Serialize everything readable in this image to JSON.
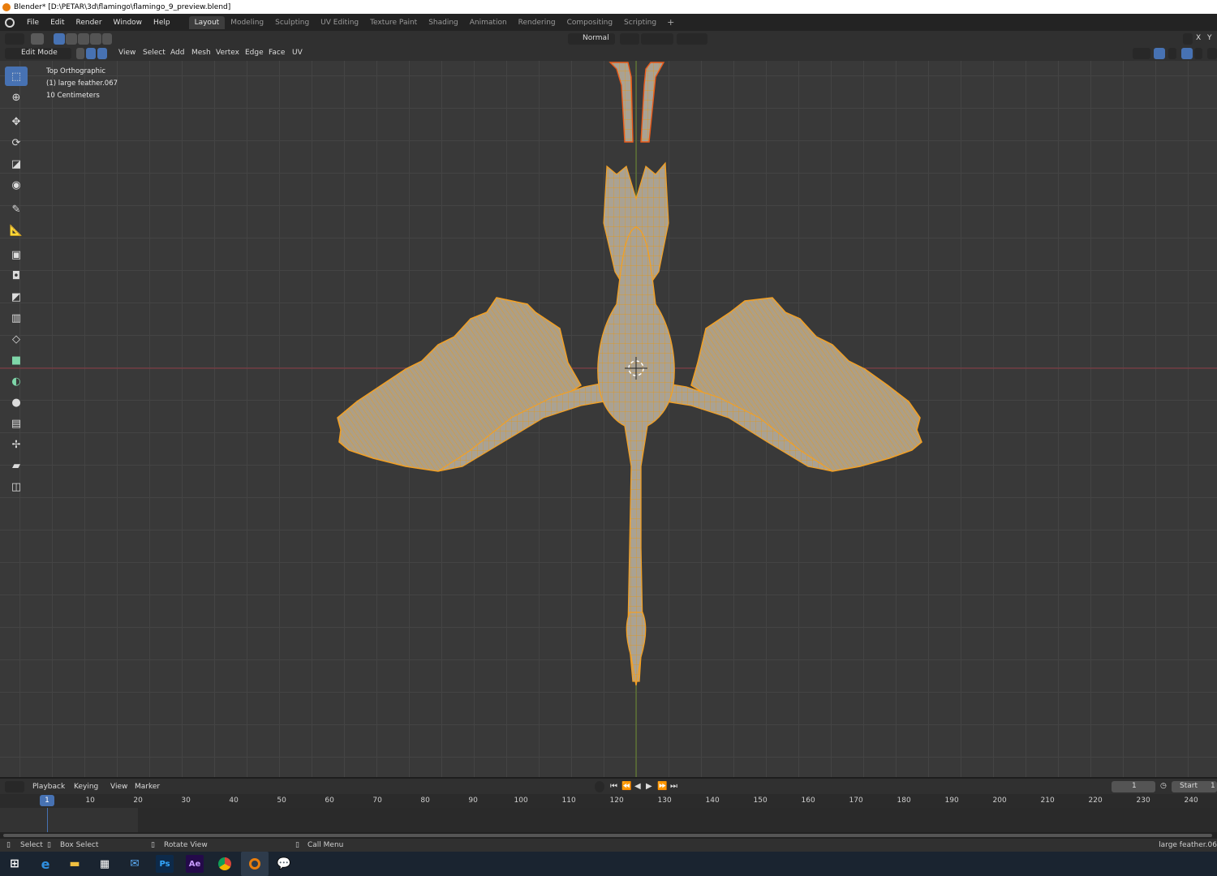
{
  "window_title": "Blender* [D:\\PETAR\\3d\\flamingo\\flamingo_9_preview.blend]",
  "menu": [
    "File",
    "Edit",
    "Render",
    "Window",
    "Help"
  ],
  "workspace_tabs": [
    "Layout",
    "Modeling",
    "Sculpting",
    "UV Editing",
    "Texture Paint",
    "Shading",
    "Animation",
    "Rendering",
    "Compositing",
    "Scripting"
  ],
  "active_tab": "Layout",
  "header": {
    "mode": "Edit Mode",
    "menus": [
      "View",
      "Select",
      "Add",
      "Mesh",
      "Vertex",
      "Edge",
      "Face",
      "UV"
    ],
    "orientation": "Normal",
    "axes": [
      "X",
      "Y"
    ]
  },
  "viewport": {
    "view_name": "Top Orthographic",
    "object_name": "(1) large feather.067",
    "grid_scale": "10 Centimeters"
  },
  "timeline": {
    "menus": [
      "Playback",
      "Keying",
      "View",
      "Marker"
    ],
    "current_frame": "1",
    "start_label": "Start",
    "start_value": "1",
    "ticks": [
      "1",
      "10",
      "20",
      "30",
      "40",
      "50",
      "60",
      "70",
      "80",
      "90",
      "100",
      "110",
      "120",
      "130",
      "140",
      "150",
      "160",
      "170",
      "180",
      "190",
      "200",
      "210",
      "220",
      "230",
      "240"
    ]
  },
  "status": {
    "select": "Select",
    "box_select": "Box Select",
    "rotate_view": "Rotate View",
    "call_menu": "Call Menu",
    "right": "large feather.06"
  },
  "taskbar_icons": [
    "windows-start",
    "edge",
    "file-explorer",
    "store",
    "mail",
    "photoshop",
    "after-effects",
    "chrome",
    "blender",
    "chat"
  ],
  "colors": {
    "accent": "#4772b3",
    "selection": "#f5a623",
    "mesh": "#a8a39b"
  }
}
